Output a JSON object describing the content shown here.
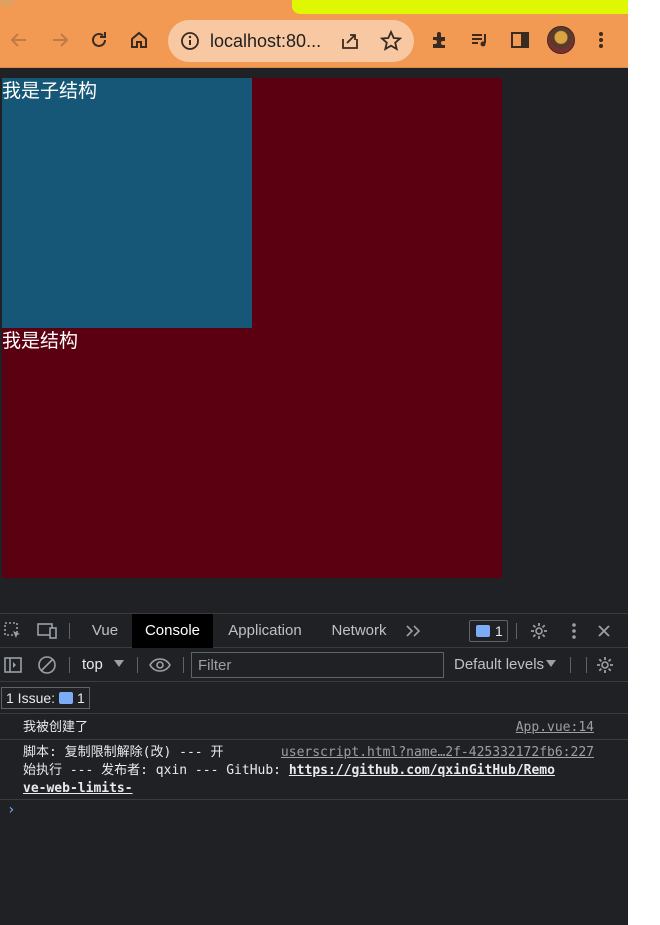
{
  "browser": {
    "url": "localhost:80...",
    "colors": {
      "toolbar": "#f29954",
      "tab_accent": "#dff700"
    },
    "icons": [
      "back-icon",
      "forward-icon",
      "reload-icon",
      "home-icon",
      "info-icon",
      "share-icon",
      "star-icon",
      "extensions-icon",
      "media-icon",
      "sidepanel-icon",
      "profile-avatar",
      "menu-icon"
    ]
  },
  "page": {
    "parent_text": "我是结构",
    "child_text": "我是子结构",
    "colors": {
      "parent": "#5b0010",
      "child": "#165676"
    }
  },
  "devtools": {
    "tabs": [
      {
        "label": "Vue",
        "active": false
      },
      {
        "label": "Console",
        "active": true
      },
      {
        "label": "Application",
        "active": false
      },
      {
        "label": "Network",
        "active": false
      }
    ],
    "issue_count": "1",
    "context": "top",
    "filter_placeholder": "Filter",
    "levels": "Default levels",
    "issues_label": "1 Issue:",
    "issues_count": "1",
    "logs": [
      {
        "text": "我被创建了",
        "source": "App.vue:14"
      },
      {
        "line1": "脚本: 复制限制解除(改) --- 开",
        "source": "userscript.html?name…2f-425332172fb6:227",
        "line2_prefix": "始执行 --- 发布者: qxin --- GitHub: ",
        "link_part1": "https://github.com/qxinGitHub/Remo",
        "link_part2": "ve-web-limits-"
      }
    ],
    "prompt": "›"
  }
}
